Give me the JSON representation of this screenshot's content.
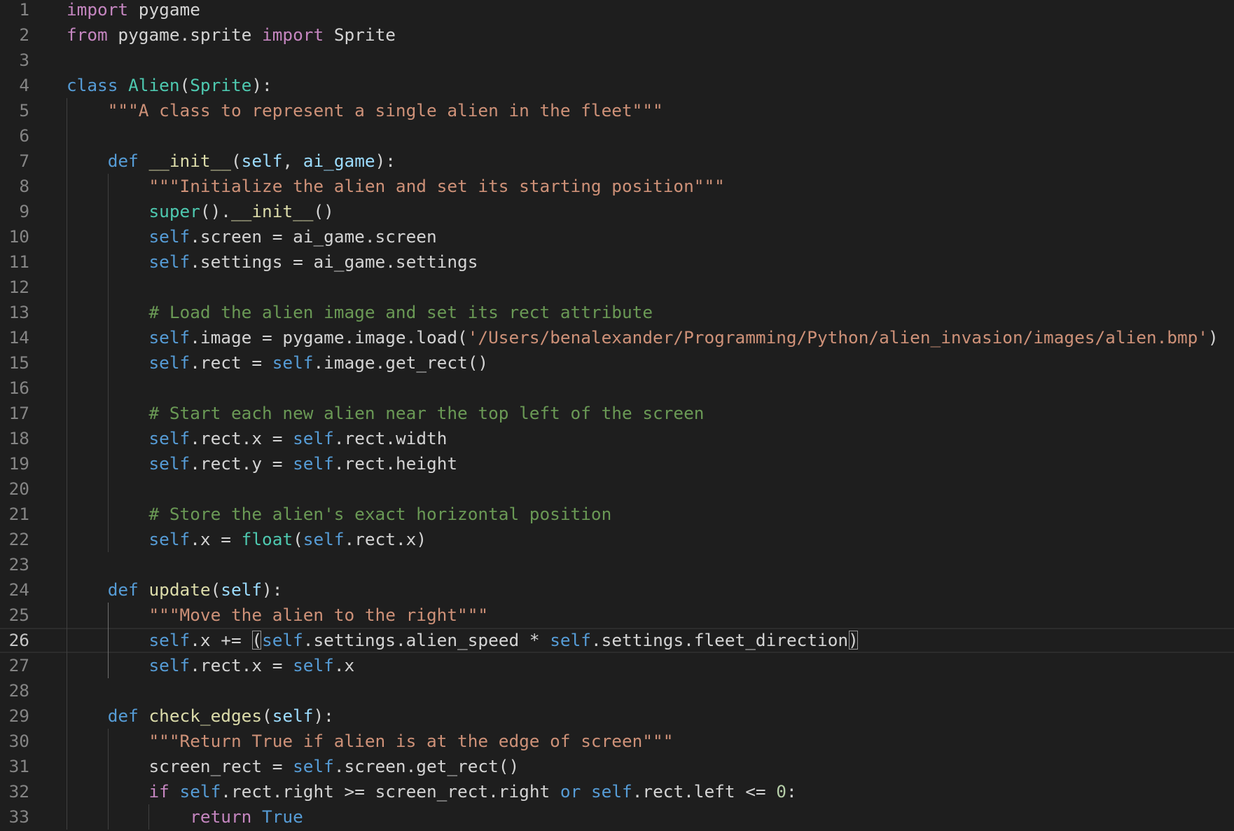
{
  "editor": {
    "language": "python",
    "current_line": 26,
    "colors": {
      "background": "#1e1e1e",
      "line_number": "#858585",
      "keyword_control": "#c586c0",
      "keyword_storage": "#569cd6",
      "class_name": "#4ec9b0",
      "function": "#dcdcaa",
      "string": "#ce9178",
      "comment": "#6a9955",
      "number": "#b5cea8",
      "parameter": "#9cdcfe",
      "text": "#d4d4d4"
    },
    "lines": [
      {
        "n": "1",
        "tokens": [
          {
            "t": "import",
            "k": "kw"
          },
          {
            "t": " pygame"
          }
        ]
      },
      {
        "n": "2",
        "tokens": [
          {
            "t": "from",
            "k": "kw"
          },
          {
            "t": " pygame.sprite "
          },
          {
            "t": "import",
            "k": "kw"
          },
          {
            "t": " Sprite"
          }
        ]
      },
      {
        "n": "3",
        "tokens": []
      },
      {
        "n": "4",
        "tokens": [
          {
            "t": "class",
            "k": "st"
          },
          {
            "t": " "
          },
          {
            "t": "Alien",
            "k": "cls"
          },
          {
            "t": "("
          },
          {
            "t": "Sprite",
            "k": "cls"
          },
          {
            "t": "):"
          }
        ]
      },
      {
        "n": "5",
        "tokens": [
          {
            "t": "    "
          },
          {
            "t": "\"\"\"A class to represent a single alien in the fleet\"\"\"",
            "k": "str"
          }
        ]
      },
      {
        "n": "6",
        "tokens": []
      },
      {
        "n": "7",
        "tokens": [
          {
            "t": "    "
          },
          {
            "t": "def",
            "k": "st"
          },
          {
            "t": " "
          },
          {
            "t": "__init__",
            "k": "fn"
          },
          {
            "t": "("
          },
          {
            "t": "self",
            "k": "prm"
          },
          {
            "t": ", "
          },
          {
            "t": "ai_game",
            "k": "prm"
          },
          {
            "t": "):"
          }
        ]
      },
      {
        "n": "8",
        "tokens": [
          {
            "t": "        "
          },
          {
            "t": "\"\"\"Initialize the alien and set its starting position\"\"\"",
            "k": "str"
          }
        ]
      },
      {
        "n": "9",
        "tokens": [
          {
            "t": "        "
          },
          {
            "t": "super",
            "k": "cls"
          },
          {
            "t": "()."
          },
          {
            "t": "__init__",
            "k": "fn"
          },
          {
            "t": "()"
          }
        ]
      },
      {
        "n": "10",
        "tokens": [
          {
            "t": "        "
          },
          {
            "t": "self",
            "k": "st"
          },
          {
            "t": ".screen = ai_game.screen"
          }
        ]
      },
      {
        "n": "11",
        "tokens": [
          {
            "t": "        "
          },
          {
            "t": "self",
            "k": "st"
          },
          {
            "t": ".settings = ai_game.settings"
          }
        ]
      },
      {
        "n": "12",
        "tokens": []
      },
      {
        "n": "13",
        "tokens": [
          {
            "t": "        "
          },
          {
            "t": "# Load the alien image and set its rect attribute",
            "k": "cmt"
          }
        ]
      },
      {
        "n": "14",
        "tokens": [
          {
            "t": "        "
          },
          {
            "t": "self",
            "k": "st"
          },
          {
            "t": ".image = pygame.image.load("
          },
          {
            "t": "'/Users/benalexander/Programming/Python/alien_invasion/images/alien.bmp'",
            "k": "str"
          },
          {
            "t": ")"
          }
        ]
      },
      {
        "n": "15",
        "tokens": [
          {
            "t": "        "
          },
          {
            "t": "self",
            "k": "st"
          },
          {
            "t": ".rect = "
          },
          {
            "t": "self",
            "k": "st"
          },
          {
            "t": ".image.get_rect()"
          }
        ]
      },
      {
        "n": "16",
        "tokens": []
      },
      {
        "n": "17",
        "tokens": [
          {
            "t": "        "
          },
          {
            "t": "# Start each new alien near the top left of the screen",
            "k": "cmt"
          }
        ]
      },
      {
        "n": "18",
        "tokens": [
          {
            "t": "        "
          },
          {
            "t": "self",
            "k": "st"
          },
          {
            "t": ".rect.x = "
          },
          {
            "t": "self",
            "k": "st"
          },
          {
            "t": ".rect.width"
          }
        ]
      },
      {
        "n": "19",
        "tokens": [
          {
            "t": "        "
          },
          {
            "t": "self",
            "k": "st"
          },
          {
            "t": ".rect.y = "
          },
          {
            "t": "self",
            "k": "st"
          },
          {
            "t": ".rect.height"
          }
        ]
      },
      {
        "n": "20",
        "tokens": []
      },
      {
        "n": "21",
        "tokens": [
          {
            "t": "        "
          },
          {
            "t": "# Store the alien's exact horizontal position",
            "k": "cmt"
          }
        ]
      },
      {
        "n": "22",
        "tokens": [
          {
            "t": "        "
          },
          {
            "t": "self",
            "k": "st"
          },
          {
            "t": ".x = "
          },
          {
            "t": "float",
            "k": "cls"
          },
          {
            "t": "("
          },
          {
            "t": "self",
            "k": "st"
          },
          {
            "t": ".rect.x)"
          }
        ]
      },
      {
        "n": "23",
        "tokens": []
      },
      {
        "n": "24",
        "tokens": [
          {
            "t": "    "
          },
          {
            "t": "def",
            "k": "st"
          },
          {
            "t": " "
          },
          {
            "t": "update",
            "k": "fn"
          },
          {
            "t": "("
          },
          {
            "t": "self",
            "k": "prm"
          },
          {
            "t": "):"
          }
        ]
      },
      {
        "n": "25",
        "tokens": [
          {
            "t": "        "
          },
          {
            "t": "\"\"\"Move the alien to the right\"\"\"",
            "k": "str"
          }
        ]
      },
      {
        "n": "26",
        "tokens": [
          {
            "t": "        "
          },
          {
            "t": "self",
            "k": "st"
          },
          {
            "t": ".x += "
          },
          {
            "t": "(",
            "k": "bp"
          },
          {
            "t": "self",
            "k": "st"
          },
          {
            "t": ".settings.alien_speed * "
          },
          {
            "t": "self",
            "k": "st"
          },
          {
            "t": ".settings.fleet_direction"
          },
          {
            "t": ")",
            "k": "bp"
          }
        ]
      },
      {
        "n": "27",
        "tokens": [
          {
            "t": "        "
          },
          {
            "t": "self",
            "k": "st"
          },
          {
            "t": ".rect.x = "
          },
          {
            "t": "self",
            "k": "st"
          },
          {
            "t": ".x"
          }
        ]
      },
      {
        "n": "28",
        "tokens": []
      },
      {
        "n": "29",
        "tokens": [
          {
            "t": "    "
          },
          {
            "t": "def",
            "k": "st"
          },
          {
            "t": " "
          },
          {
            "t": "check_edges",
            "k": "fn"
          },
          {
            "t": "("
          },
          {
            "t": "self",
            "k": "prm"
          },
          {
            "t": "):"
          }
        ]
      },
      {
        "n": "30",
        "tokens": [
          {
            "t": "        "
          },
          {
            "t": "\"\"\"Return True if alien is at the edge of screen\"\"\"",
            "k": "str"
          }
        ]
      },
      {
        "n": "31",
        "tokens": [
          {
            "t": "        screen_rect = "
          },
          {
            "t": "self",
            "k": "st"
          },
          {
            "t": ".screen.get_rect()"
          }
        ]
      },
      {
        "n": "32",
        "tokens": [
          {
            "t": "        "
          },
          {
            "t": "if",
            "k": "kw"
          },
          {
            "t": " "
          },
          {
            "t": "self",
            "k": "st"
          },
          {
            "t": ".rect.right >= screen_rect.right "
          },
          {
            "t": "or",
            "k": "st"
          },
          {
            "t": " "
          },
          {
            "t": "self",
            "k": "st"
          },
          {
            "t": ".rect.left <= "
          },
          {
            "t": "0",
            "k": "num"
          },
          {
            "t": ":"
          }
        ]
      },
      {
        "n": "33",
        "tokens": [
          {
            "t": "            "
          },
          {
            "t": "return",
            "k": "kw"
          },
          {
            "t": " "
          },
          {
            "t": "True",
            "k": "st"
          }
        ]
      }
    ]
  }
}
